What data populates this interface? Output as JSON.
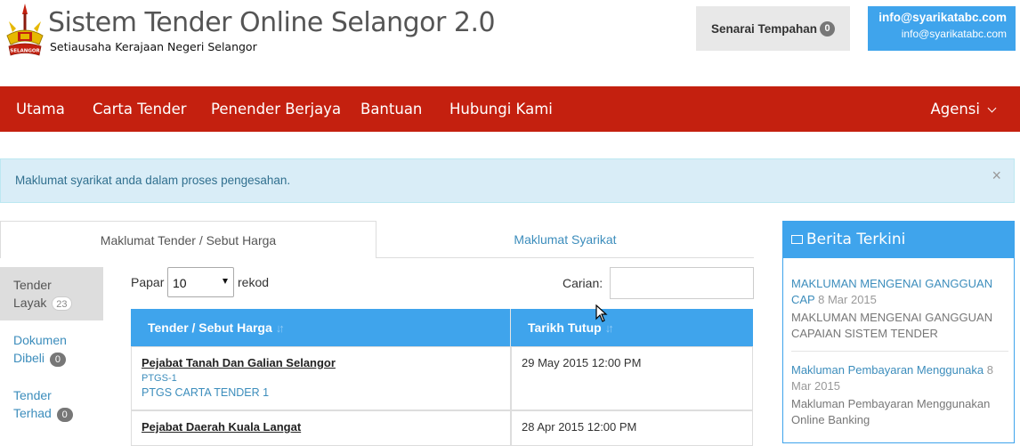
{
  "header": {
    "title": "Sistem Tender Online Selangor 2.0",
    "subtitle": "Setiausaha Kerajaan Negeri Selangor",
    "logo_text": "SELANGOR",
    "tempahan_label": "Senarai Tempahan",
    "tempahan_count": "0",
    "user_email": "info@syarikatabc.com",
    "user_email_sub": "info@syarikatabc.com"
  },
  "nav": {
    "items": [
      "Utama",
      "Carta Tender",
      "Penender Berjaya",
      "Bantuan",
      "Hubungi Kami"
    ],
    "agensi": "Agensi"
  },
  "alert": {
    "text": "Maklumat syarikat anda dalam proses pengesahan.",
    "close": "×"
  },
  "tabs": {
    "active": "Maklumat Tender / Sebut Harga",
    "inactive": "Maklumat Syarikat"
  },
  "vnav": {
    "items": [
      {
        "line1": "Tender",
        "line2": "Layak",
        "count": "23"
      },
      {
        "line1": "Dokumen",
        "line2": "Dibeli",
        "count": "0"
      },
      {
        "line1": "Tender",
        "line2": "Terhad",
        "count": "0"
      }
    ]
  },
  "controls": {
    "papar": "Papar",
    "select_value": "10",
    "rekod": "rekod",
    "carian": "Carian:"
  },
  "table": {
    "headers": [
      "Tender / Sebut Harga",
      "Tarikh Tutup"
    ],
    "rows": [
      {
        "agency": "Pejabat Tanah Dan Galian Selangor",
        "code": "PTGS-1",
        "name": "PTGS CARTA TENDER 1",
        "date": "29 May 2015 12:00 PM"
      },
      {
        "agency": "Pejabat Daerah Kuala Langat",
        "code": "",
        "name": "",
        "date": "28 Apr 2015 12:00 PM"
      }
    ]
  },
  "berita": {
    "title": "Berita Terkini",
    "items": [
      {
        "title": "MAKLUMAN MENGENAI GANGGUAN CAP",
        "date": "8 Mar 2015",
        "desc": "MAKLUMAN MENGENAI GANGGUAN CAPAIAN SISTEM TENDER"
      },
      {
        "title": "Makluman Pembayaran Menggunaka",
        "date": "8 Mar 2015",
        "desc": "Makluman Pembayaran Menggunakan Online Banking"
      }
    ]
  },
  "colors": {
    "brand_red": "#c4200f",
    "accent_blue": "#3fa4ec",
    "link_blue": "#3c8dbc",
    "alert_bg": "#d9edf7"
  }
}
